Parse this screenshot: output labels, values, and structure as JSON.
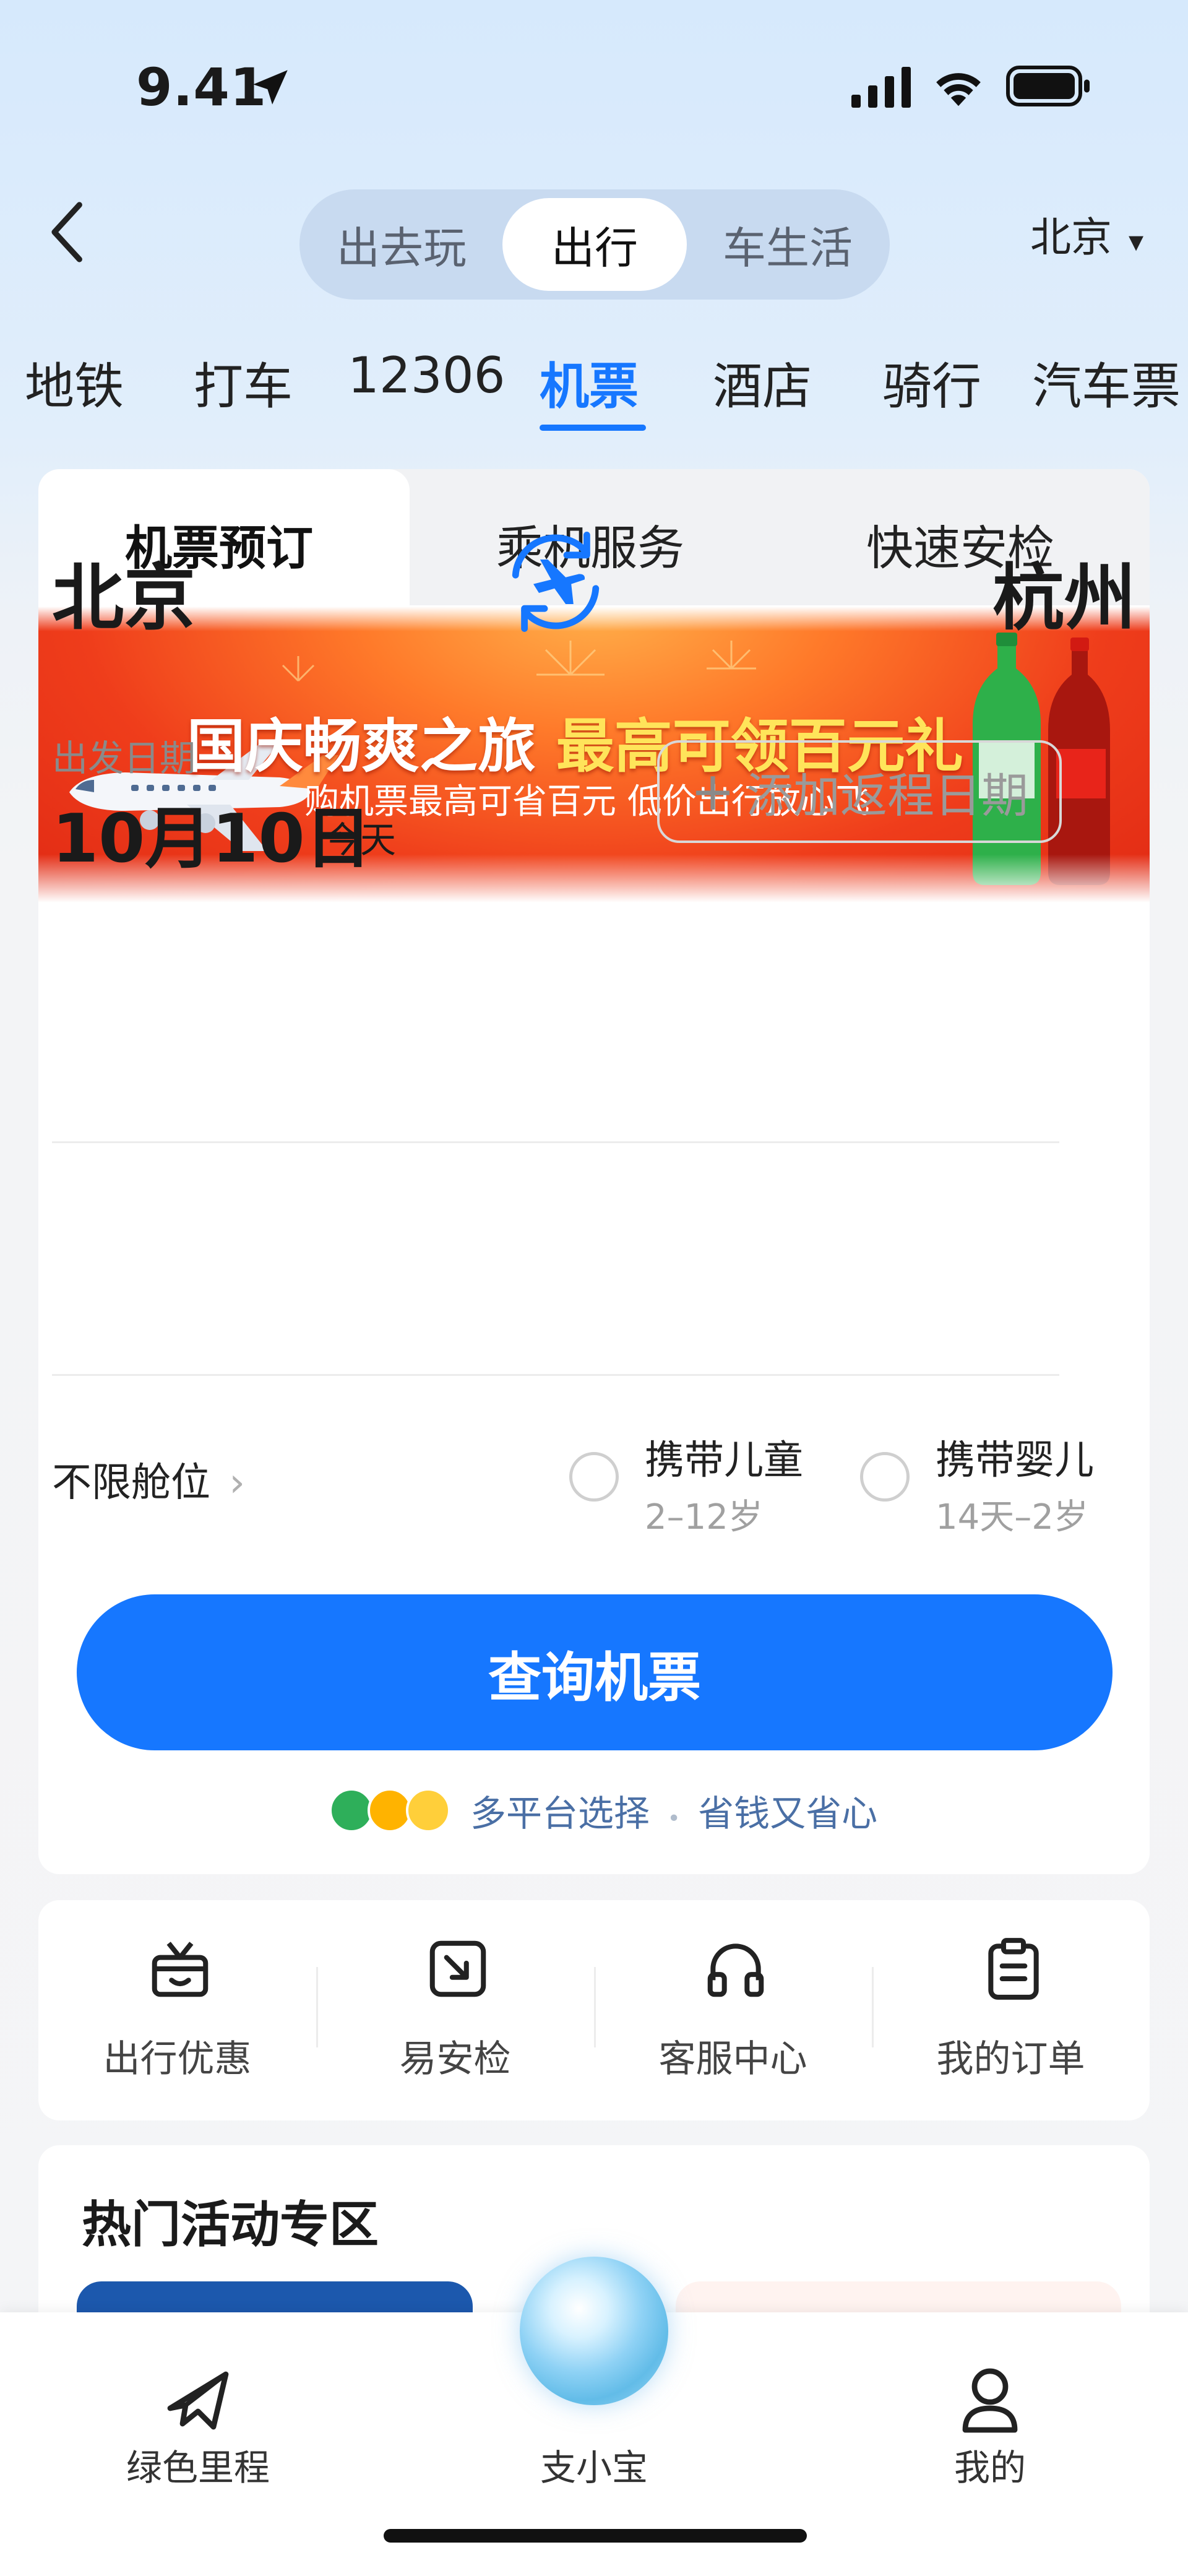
{
  "status_bar": {
    "time": "9.41"
  },
  "header": {
    "segments": [
      "出去玩",
      "出行",
      "车生活"
    ],
    "active_segment": "出行",
    "city": "北京",
    "city_arrow": "▾"
  },
  "categories": [
    "地铁",
    "打车",
    "12306",
    "机票",
    "酒店",
    "骑行",
    "汽车票"
  ],
  "active_category": "机票",
  "flight_tabs": [
    "机票预订",
    "乘机服务",
    "快速安检"
  ],
  "banner": {
    "title_main": "国庆畅爽之旅",
    "title_highlight": "最高可领百元礼",
    "subtitle": "购机票最高可省百元 低价出行放心飞"
  },
  "route": {
    "from": "北京",
    "to": "杭州",
    "swap_icon": "plane-swap-icon"
  },
  "date": {
    "label": "出发日期",
    "value": "10月10日",
    "today": "今天",
    "return_btn": "添加返程日期",
    "return_plus": "+"
  },
  "options": {
    "cabin": "不限舱位",
    "cabin_arrow": "›",
    "child_title": "携带儿童",
    "child_sub": "2–12岁",
    "infant_title": "携带婴儿",
    "infant_sub": "14天–2岁"
  },
  "query_button": "查询机票",
  "multi_platform": {
    "text": "多平台选择",
    "dot": "•",
    "text2": "省钱又省心"
  },
  "services": [
    "出行优惠",
    "易安检",
    "客服中心",
    "我的订单"
  ],
  "hot": {
    "title": "热门活动专区"
  },
  "bottom_nav": [
    "绿色里程",
    "支小宝",
    "我的"
  ],
  "colors": {
    "primary": "#1677ff",
    "banner_red": "#e12a14",
    "highlight_yellow": "#ffe45a"
  }
}
